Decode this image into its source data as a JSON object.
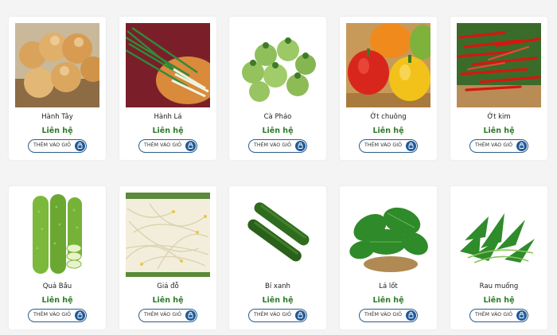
{
  "products": [
    {
      "name": "Hành Tây",
      "price": "Liên hệ",
      "button": "THÊM VÀO GIỎ",
      "icon": "shopping-bag-icon",
      "image": "onion"
    },
    {
      "name": "Hành Lá",
      "price": "Liên hệ",
      "button": "THÊM VÀO GIỎ",
      "icon": "shopping-bag-icon",
      "image": "green-onion"
    },
    {
      "name": "Cà Pháo",
      "price": "Liên hệ",
      "button": "THÊM VÀO GIỎ",
      "icon": "shopping-bag-icon",
      "image": "eggplant"
    },
    {
      "name": "Ớt chuông",
      "price": "Liên hệ",
      "button": "THÊM VÀO GIỎ",
      "icon": "shopping-bag-icon",
      "image": "bell-pepper"
    },
    {
      "name": "Ớt kim",
      "price": "Liên hệ",
      "button": "THÊM VÀO GIỎ",
      "icon": "shopping-bag-icon",
      "image": "chili"
    },
    {
      "name": "Quả Bầu",
      "price": "Liên hệ",
      "button": "THÊM VÀO GIỎ",
      "icon": "shopping-bag-icon",
      "image": "gourd"
    },
    {
      "name": "Giá đỗ",
      "price": "Liên hệ",
      "button": "THÊM VÀO GIỎ",
      "icon": "shopping-bag-icon",
      "image": "bean-sprout"
    },
    {
      "name": "Bí xanh",
      "price": "Liên hệ",
      "button": "THÊM VÀO GIỎ",
      "icon": "shopping-bag-icon",
      "image": "cucumber"
    },
    {
      "name": "Lá lốt",
      "price": "Liên hệ",
      "button": "THÊM VÀO GIỎ",
      "icon": "shopping-bag-icon",
      "image": "betel-leaf"
    },
    {
      "name": "Rau muống",
      "price": "Liên hệ",
      "button": "THÊM VÀO GIỎ",
      "icon": "shopping-bag-icon",
      "image": "water-spinach"
    }
  ],
  "colors": {
    "price": "#2f7a2a",
    "button_border": "#2c5d8a",
    "bag_icon_bg": "#1f5a99",
    "page_bg": "#f4f4f4"
  }
}
